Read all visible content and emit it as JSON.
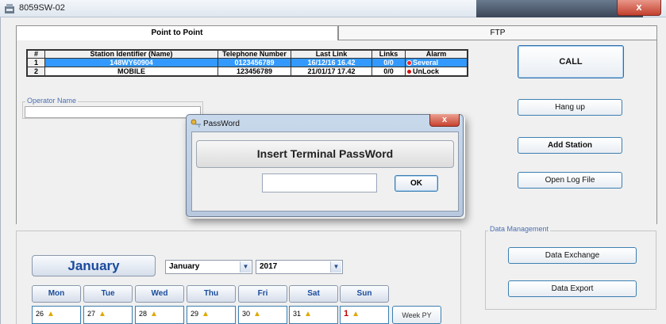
{
  "window": {
    "title": "8059SW-02",
    "close_glyph": "x"
  },
  "tabs": [
    {
      "label": "Point to Point",
      "active": true
    },
    {
      "label": "FTP",
      "active": false
    }
  ],
  "stations": {
    "headers": [
      "#",
      "Station Identifier (Name)",
      "Telephone Number",
      "Last Link",
      "Links",
      "Alarm"
    ],
    "rows": [
      {
        "index": "1",
        "name": "148WY60904",
        "phone": "0123456789",
        "last_link": "16/12/16 16.42",
        "links": "0/0",
        "alarm": "Several",
        "selected": true
      },
      {
        "index": "2",
        "name": "MOBILE",
        "phone": "123456789",
        "last_link": "21/01/17 17.42",
        "links": "0/0",
        "alarm": "UnLock",
        "selected": false
      }
    ]
  },
  "operator": {
    "label": "Operator Name",
    "value": ""
  },
  "actions": {
    "call": "CALL",
    "hang_up": "Hang up",
    "add_station": "Add Station",
    "open_log": "Open Log File"
  },
  "data_management": {
    "label": "Data Management",
    "exchange": "Data Exchange",
    "export": "Data Export"
  },
  "calendar": {
    "month_title": "January",
    "month_select": "January",
    "year_select": "2017",
    "days": [
      "Mon",
      "Tue",
      "Wed",
      "Thu",
      "Fri",
      "Sat",
      "Sun"
    ],
    "first_row": [
      "26",
      "27",
      "28",
      "29",
      "30",
      "31",
      "1"
    ],
    "week_button": "Week PY",
    "warning_icon": "warning-triangle"
  },
  "password_dialog": {
    "title": "PassWord",
    "prompt": "Insert Terminal PassWord",
    "value": "",
    "ok": "OK",
    "close_glyph": "x"
  },
  "colors": {
    "selection": "#3399ff",
    "alarm_dot": "#d01010",
    "month_text": "#1a4b9c"
  }
}
